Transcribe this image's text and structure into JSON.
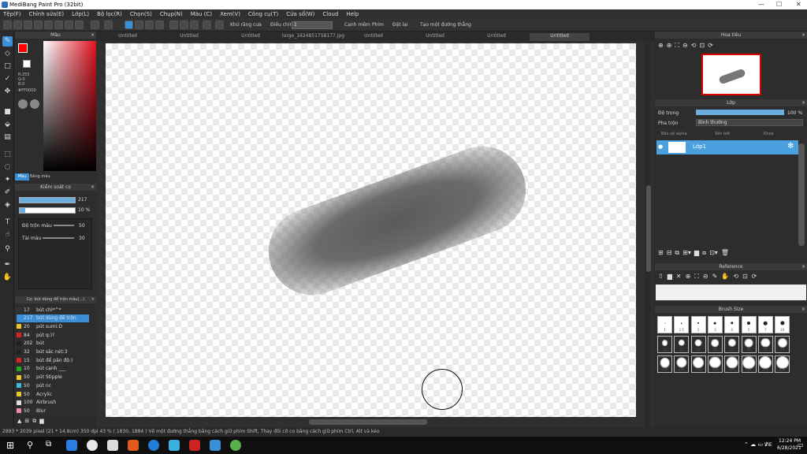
{
  "app": {
    "title": "MediBang Paint Pro (32bit)"
  },
  "menu": [
    "Tệp(F)",
    "Chỉnh sửa(E)",
    "Lớp(L)",
    "Bộ lọc(R)",
    "Chọn(S)",
    "Chụp(N)",
    "Màu (C)",
    "Xem(V)",
    "Công cụ(T)",
    "Cửa sổ(W)",
    "Cloud",
    "Help"
  ],
  "toolbar": {
    "antialias": "Khử răng cưa",
    "correction_label": "Điều chỉnh",
    "correction_value": "1",
    "edge_pen": "Cạnh mềm",
    "snap": "Phím",
    "snap_off": "Đặt lại",
    "create_line": "Tạo một đường thẳng"
  },
  "tabs": [
    "Untitled",
    "Untitled",
    "Untitled",
    "large_1624851758177.jpg",
    "Untitled",
    "Untitled",
    "Untitled",
    "Untitled"
  ],
  "color_panel": {
    "title": "Màu",
    "r": "R:255",
    "g": "G:0",
    "b": "B:0",
    "hex": "#FF0000",
    "tab1": "Màu",
    "tab2": "Bảng màu",
    "main_color": "#ff0000"
  },
  "brush_panel": {
    "title": "Kiểm soát cọ",
    "size": "217",
    "opacity": "10 %",
    "blend_label": "Độ trộn màu",
    "blend_value": "50",
    "reload_label": "Tải màu",
    "reload_value": "30"
  },
  "brush_list": {
    "title": "Cọ: bút dùng để trộn màu(...)",
    "items": [
      {
        "n": "17",
        "name": "bút chì*^*",
        "color": "#333333"
      },
      {
        "n": "217",
        "name": "bút dùng để trộn",
        "color": "#3b8fd6",
        "sel": true
      },
      {
        "n": "20",
        "name": "pút sumi:D",
        "color": "#e8c82a"
      },
      {
        "n": "84",
        "name": "pút q:)?",
        "color": "#d22"
      },
      {
        "n": "202",
        "name": "bút",
        "color": "#222"
      },
      {
        "n": "32",
        "name": "bút sắc nét:3",
        "color": "#222"
      },
      {
        "n": "15",
        "name": "bút để pân độ:)",
        "color": "#d22"
      },
      {
        "n": "10",
        "name": "bút cạnh ___",
        "color": "#2a2"
      },
      {
        "n": "50",
        "name": "pút Stipple",
        "color": "#e8c82a"
      },
      {
        "n": "50",
        "name": "pút nc",
        "color": "#3bbbd6"
      },
      {
        "n": "50",
        "name": "Acrylic",
        "color": "#e8c82a"
      },
      {
        "n": "100",
        "name": "Airbrush",
        "color": "#ddd"
      },
      {
        "n": "50",
        "name": "Blur",
        "color": "#e8a"
      }
    ]
  },
  "navigator": {
    "title": "Hoa tiêu"
  },
  "layer_panel": {
    "title": "Lớp",
    "opacity_label": "Độ trong",
    "opacity_value": "100 %",
    "blend_label": "Pha trộn",
    "blend_value": "Bình thường",
    "protect_alpha": "Bảo vệ alpha",
    "clipping": "Xén bớt",
    "lock": "Khóa",
    "layer_name": "Lớp1"
  },
  "reference": {
    "title": "Reference"
  },
  "brush_size": {
    "title": "Brush Size",
    "labels": [
      "1",
      "1.5",
      "2",
      "3",
      "4",
      "5",
      "7",
      "10",
      "12",
      "15",
      "20",
      "25",
      "30",
      "40",
      "50",
      "70",
      "100",
      "150",
      "200",
      "250",
      "300",
      "400",
      "500",
      "600",
      "700",
      "800",
      "1000"
    ]
  },
  "status": "2893 * 2039 pixel  (21 * 14.8cm)  350 dpi  43 %  ( 1830, 1884 )  Vẽ một đường thẳng bằng cách giữ phím Shift, Thay đổi cỡ cọ bằng cách giữ phím Ctrl, Alt và kéo",
  "taskbar": {
    "lang": "VIE",
    "time": "12:24 PM",
    "date": "6/28/2021"
  }
}
